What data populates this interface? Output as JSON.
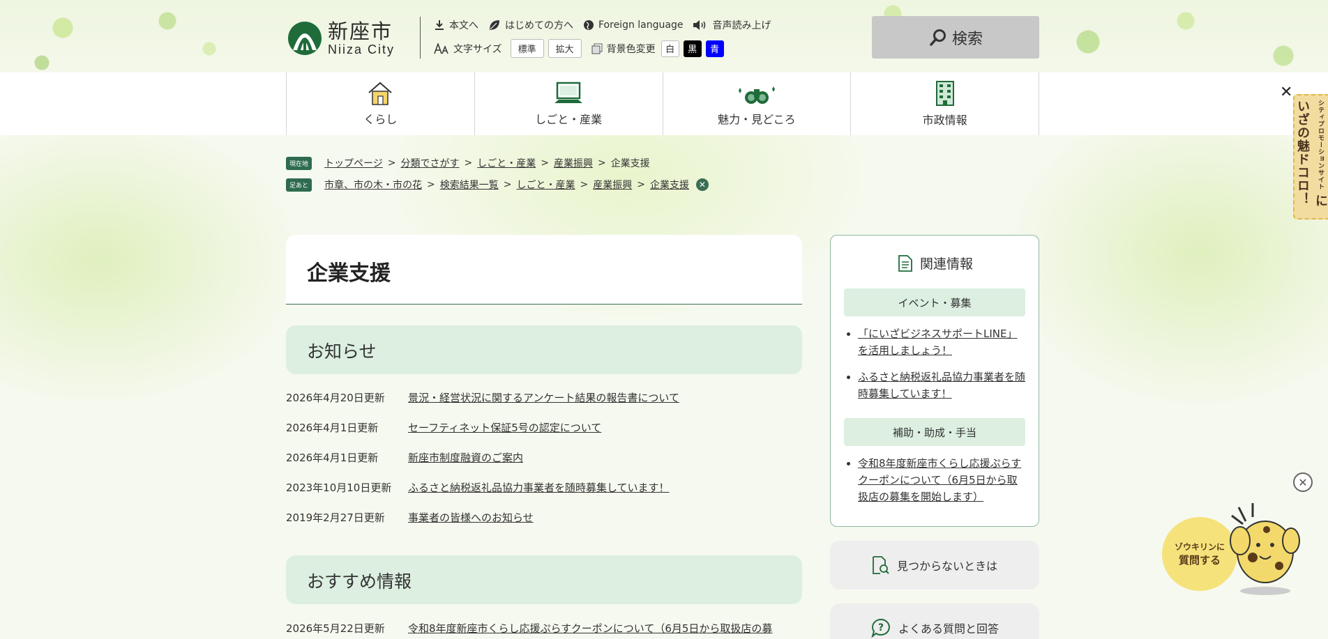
{
  "header": {
    "logo_jp": "新座市",
    "logo_en": "Niiza City",
    "utility": {
      "to_content": "本文へ",
      "beginners": "はじめての方へ",
      "foreign_language": "Foreign language",
      "read_aloud": "音声読み上げ",
      "text_size_label": "文字サイズ",
      "size_standard": "標準",
      "size_large": "拡大",
      "bg_color_label": "背景色変更",
      "bg_white": "白",
      "bg_black": "黒",
      "bg_blue": "青"
    },
    "search_label": "検索"
  },
  "global_nav": [
    {
      "label": "くらし",
      "icon": "house-icon"
    },
    {
      "label": "しごと・産業",
      "icon": "computer-icon"
    },
    {
      "label": "魅力・見どころ",
      "icon": "binoculars-icon"
    },
    {
      "label": "市政情報",
      "icon": "building-icon"
    }
  ],
  "side_banner": {
    "small_text": "シティプロモーションサイト",
    "big_text": "にいざの魅ドコロ！"
  },
  "breadcrumb": {
    "current_tag": "現在地",
    "current": [
      "トップページ",
      "分類でさがす",
      "しごと・産業",
      "産業振興",
      "企業支援"
    ],
    "history_tag": "足あと",
    "history": [
      "市章、市の木・市の花",
      "検索結果一覧",
      "しごと・産業",
      "産業振興",
      "企業支援"
    ],
    "separator": ">",
    "clear_icon": "close-circle-icon"
  },
  "page_title": "企業支援",
  "sections": {
    "news_title": "お知らせ",
    "news": [
      {
        "date": "2026年4月20日更新",
        "title": "景況・経営状況に関するアンケート結果の報告書について"
      },
      {
        "date": "2026年4月1日更新",
        "title": "セーフティネット保証5号の認定について"
      },
      {
        "date": "2026年4月1日更新",
        "title": "新座市制度融資のご案内"
      },
      {
        "date": "2023年10月10日更新",
        "title": "ふるさと納税返礼品協力事業者を随時募集しています！"
      },
      {
        "date": "2019年2月27日更新",
        "title": "事業者の皆様へのお知らせ"
      }
    ],
    "recommend_title": "おすすめ情報",
    "recommend": [
      {
        "date": "2026年5月22日更新",
        "title": "令和8年度新座市くらし応援ぷらすクーポンについて（6月5日から取扱店の募"
      }
    ]
  },
  "related": {
    "title": "関連情報",
    "categories": [
      {
        "name": "イベント・募集",
        "items": [
          "「にいざビジネスサポートLINE」を活用しましょう！",
          "ふるさと納税返礼品協力事業者を随時募集しています！"
        ]
      },
      {
        "name": "補助・助成・手当",
        "items": [
          "令和8年度新座市くらし応援ぷらすクーポンについて（6月5日から取扱店の募集を開始します）"
        ]
      }
    ]
  },
  "side_buttons": {
    "not_found": "見つからないときは",
    "faq": "よくある質問と回答"
  },
  "chat": {
    "line1": "ゾウキリンに",
    "line2": "質問する",
    "close_icon": "close-circle-icon"
  },
  "colors": {
    "accent_green": "#2e6b4f",
    "section_bg": "#dcefe0",
    "search_bg": "#c8c8c8"
  }
}
